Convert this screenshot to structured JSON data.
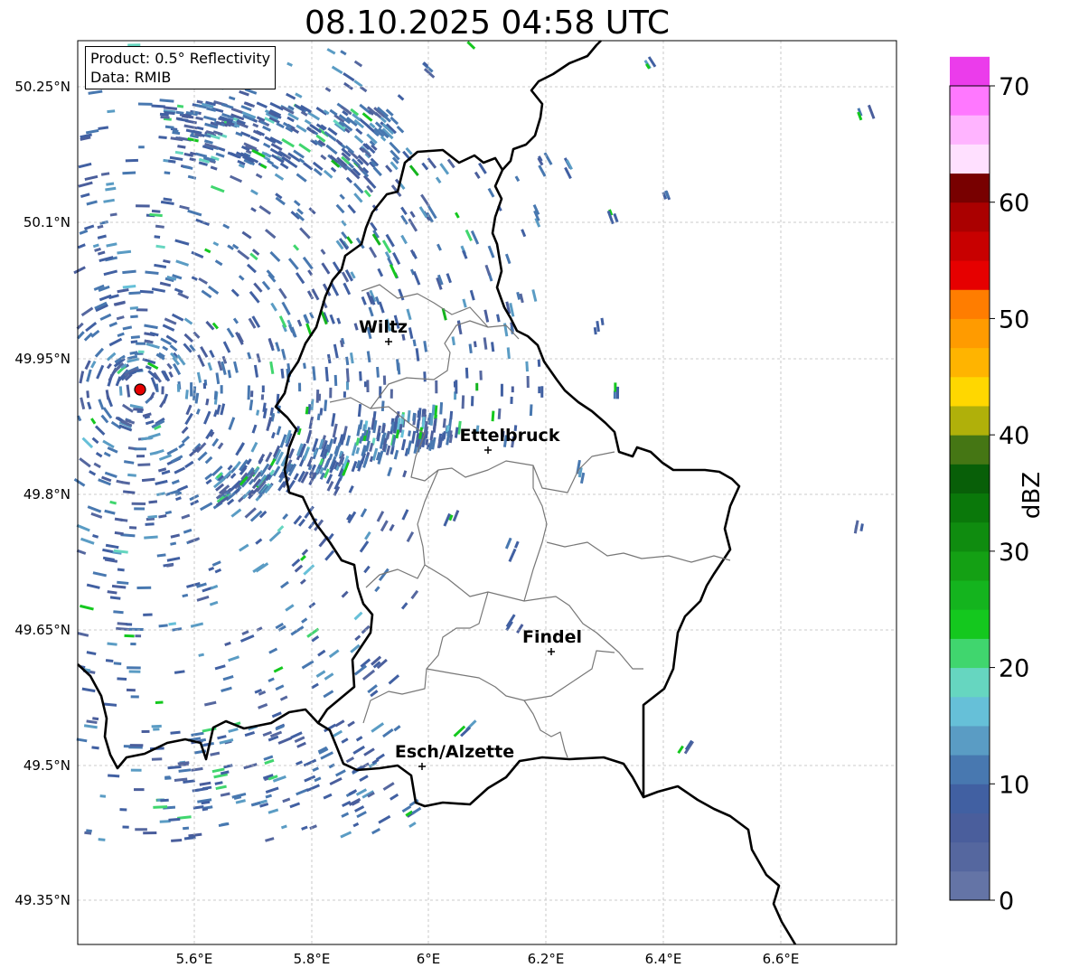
{
  "title": "08.10.2025 04:58 UTC",
  "info_box": {
    "line1": "Product: 0.5° Reflectivity",
    "line2": "Data: RMIB"
  },
  "axes": {
    "lon_ticks": [
      "5.6°E",
      "5.8°E",
      "6°E",
      "6.2°E",
      "6.4°E",
      "6.6°E"
    ],
    "lat_ticks": [
      "50.25°N",
      "50.1°N",
      "49.95°N",
      "49.8°N",
      "49.65°N",
      "49.5°N",
      "49.35°N"
    ]
  },
  "cities": [
    {
      "name": "Wiltz"
    },
    {
      "name": "Ettelbruck"
    },
    {
      "name": "Findel"
    },
    {
      "name": "Esch/Alzette"
    }
  ],
  "colorbar": {
    "label": "dBZ",
    "ticks": [
      "0",
      "10",
      "20",
      "30",
      "40",
      "50",
      "60",
      "70"
    ],
    "min": 0,
    "max": 70,
    "step": 2.5,
    "colors": [
      "#6474a6",
      "#55679f",
      "#4a5e9c",
      "#4160a2",
      "#4878b0",
      "#5a9cc4",
      "#66c0d8",
      "#66d6c0",
      "#40d66e",
      "#14c81e",
      "#14b41e",
      "#14a014",
      "#0f8c0f",
      "#0a780a",
      "#085f08",
      "#457614",
      "#b0b00a",
      "#ffd700",
      "#ffb400",
      "#ff9b00",
      "#ff7d00",
      "#e60000",
      "#c80000",
      "#aa0000",
      "#780000",
      "#ffe0ff",
      "#ffb4ff",
      "#ff78ff",
      "#eb3ceb"
    ]
  },
  "radar_site": {
    "color": "#e60000"
  }
}
